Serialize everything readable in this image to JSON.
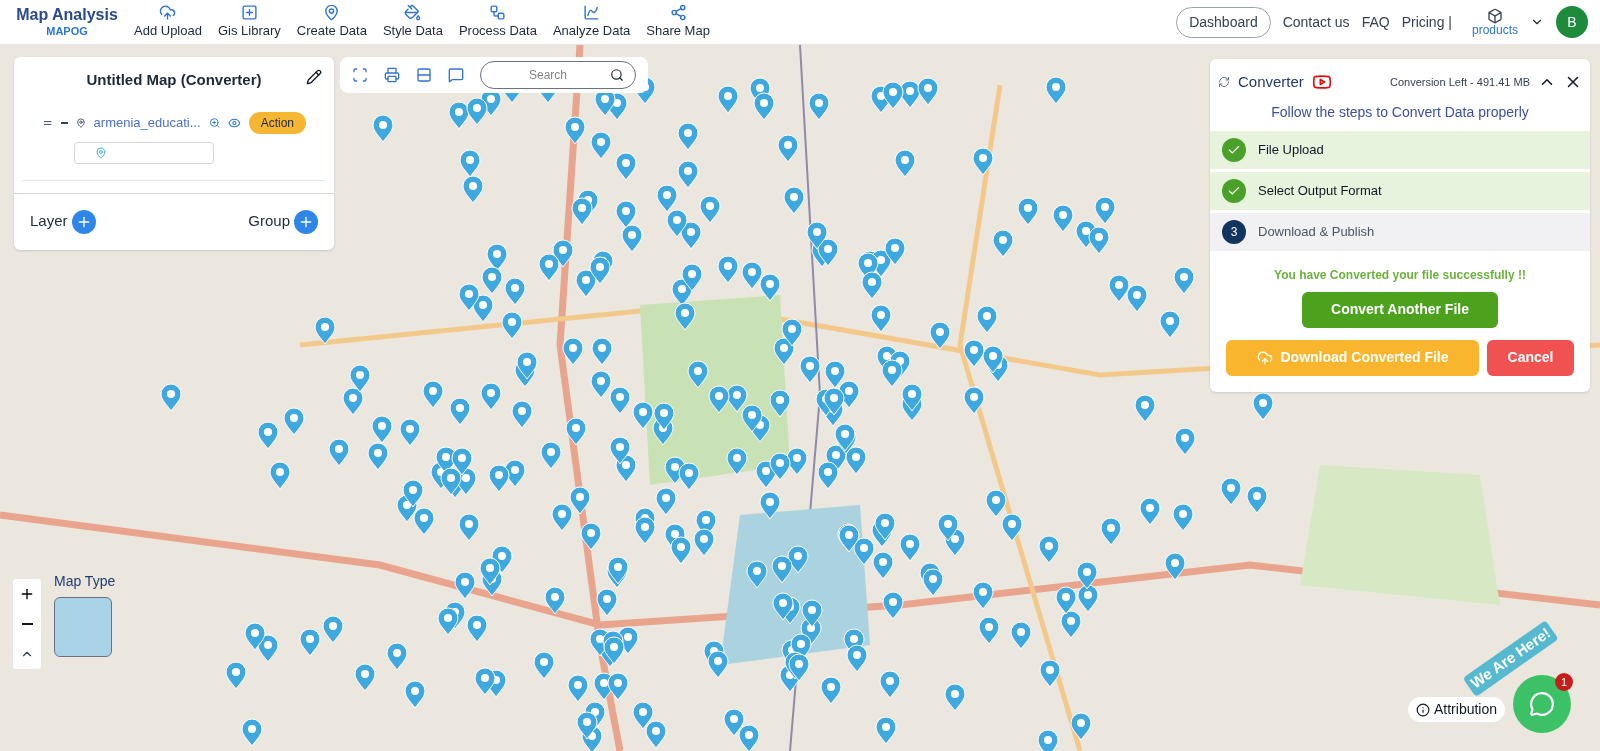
{
  "header": {
    "logo_title": "Map Analysis",
    "logo_sub": "MAPOG",
    "nav": [
      {
        "label": "Add Upload"
      },
      {
        "label": "Gis Library"
      },
      {
        "label": "Create Data"
      },
      {
        "label": "Style Data"
      },
      {
        "label": "Process Data"
      },
      {
        "label": "Analyze Data"
      },
      {
        "label": "Share Map"
      }
    ],
    "dashboard": "Dashboard",
    "links": [
      "Contact us",
      "FAQ",
      "Pricing |"
    ],
    "products": "products",
    "avatar": "B"
  },
  "layer_panel": {
    "title": "Untitled Map (Converter)",
    "layers": [
      {
        "name": "armenia_educati...",
        "action": "Action"
      }
    ],
    "layer_label": "Layer",
    "group_label": "Group"
  },
  "toolbar": {
    "search_placeholder": "Search"
  },
  "converter": {
    "title": "Converter",
    "quota": "Conversion Left - 491.41 MB",
    "subtitle": "Follow the steps to Convert Data properly",
    "steps": [
      {
        "label": "File Upload",
        "done": true
      },
      {
        "label": "Select Output Format",
        "done": true
      },
      {
        "label": "Download & Publish",
        "done": false,
        "number": "3"
      }
    ],
    "message": "You have Converted your file successfully !!",
    "convert_another": "Convert Another File",
    "download": "Download Converted File",
    "cancel": "Cancel"
  },
  "map_controls": {
    "map_type": "Map Type"
  },
  "attribution": "Attribution",
  "chat": {
    "tagline": "We Are Here!",
    "badge": "1"
  }
}
